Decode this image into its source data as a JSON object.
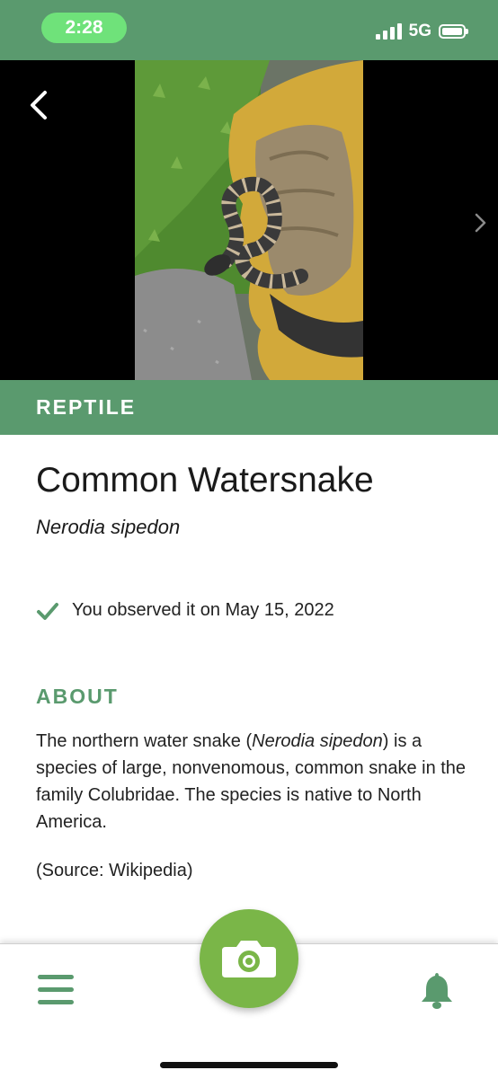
{
  "status_bar": {
    "time": "2:28",
    "network": "5G",
    "signal_bars": 4,
    "battery_level": 1.0
  },
  "hero": {
    "image_subject": "snake-on-glove-photo"
  },
  "category": "REPTILE",
  "species": {
    "common_name": "Common Watersnake",
    "scientific_name": "Nerodia sipedon"
  },
  "observation": {
    "text": "You observed it on May 15, 2022"
  },
  "about": {
    "heading": "ABOUT",
    "text_before": "The northern water snake (",
    "text_italic": "Nerodia sipedon",
    "text_after": ") is a species of large, nonvenomous, common snake in the family Colubridae. The species is native to North America.",
    "source": "(Source: Wikipedia)"
  },
  "nav": {
    "left_icon": "menu-icon",
    "center_icon": "camera-icon",
    "right_icon": "bell-icon"
  },
  "colors": {
    "brand_green": "#5a9a6e",
    "time_pill": "#6fe27a",
    "camera_button": "#7ab648"
  }
}
